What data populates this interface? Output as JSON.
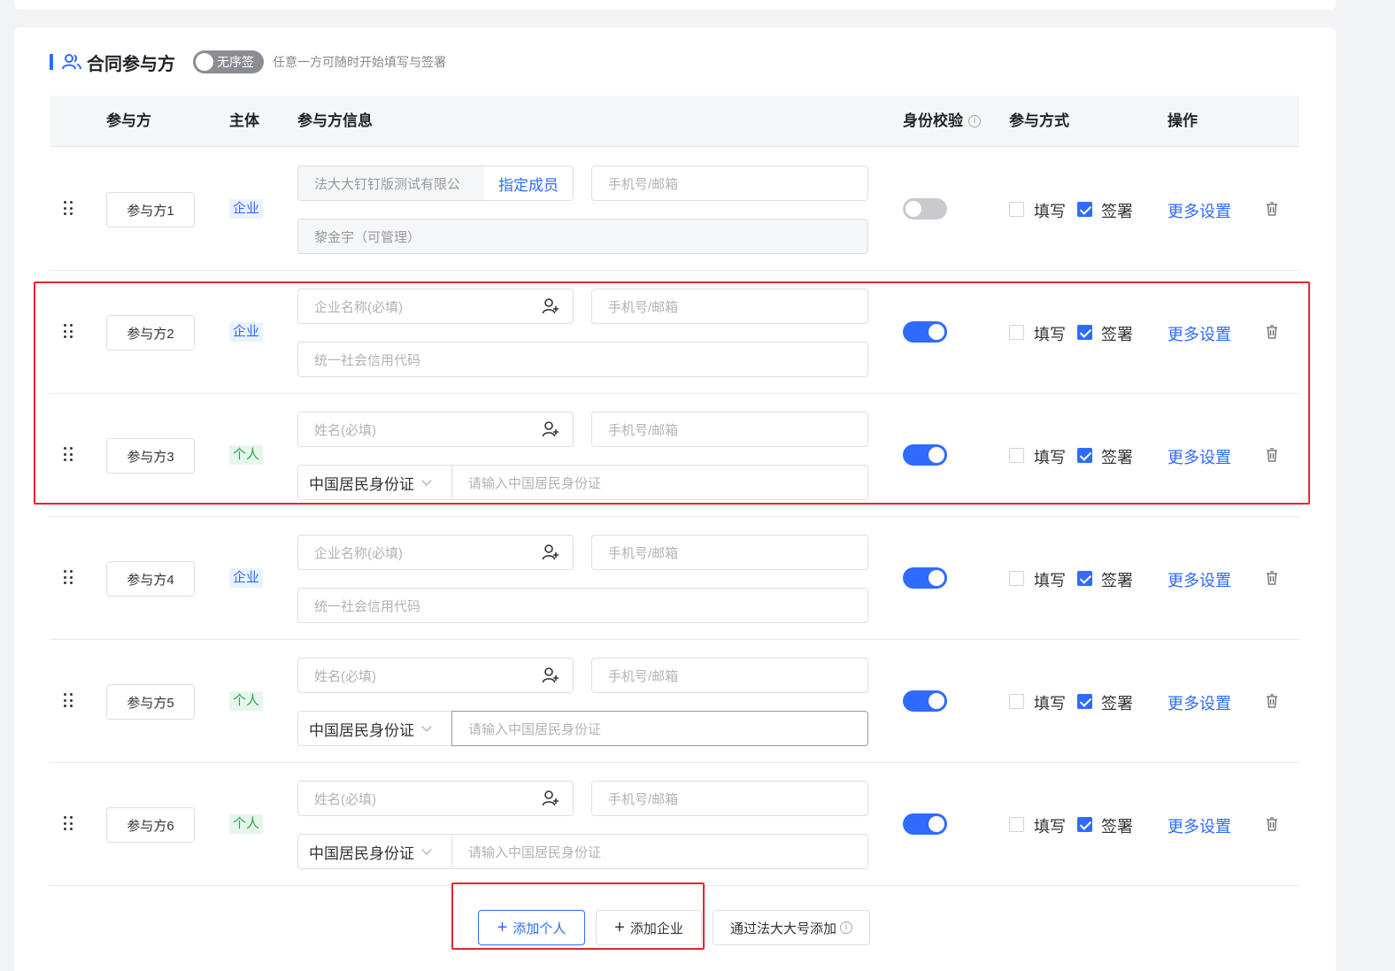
{
  "section": {
    "title": "合同参与方",
    "sequence_toggle_label": "无序签",
    "description": "任意一方可随时开始填写与签署"
  },
  "table_headers": {
    "participant": "参与方",
    "subject": "主体",
    "info": "参与方信息",
    "identity_check": "身份校验",
    "mode": "参与方式",
    "actions": "操作"
  },
  "labels": {
    "fill": "填写",
    "sign": "签署",
    "more_settings": "更多设置",
    "info_glyph": "i"
  },
  "rows": [
    {
      "name": "参与方1",
      "type": "企业",
      "kind": "enterprise-existing",
      "company_value": "法大大钉钉版测试有限公",
      "assign_member": "指定成员",
      "contact_placeholder": "手机号/邮箱",
      "member_value": "黎金宇（可管理）",
      "identity_check": false,
      "fill": false,
      "sign": true
    },
    {
      "name": "参与方2",
      "type": "企业",
      "kind": "enterprise",
      "name_placeholder": "企业名称(必填)",
      "contact_placeholder": "手机号/邮箱",
      "code_placeholder": "统一社会信用代码",
      "identity_check": true,
      "fill": false,
      "sign": true
    },
    {
      "name": "参与方3",
      "type": "个人",
      "kind": "person",
      "name_placeholder": "姓名(必填)",
      "contact_placeholder": "手机号/邮箱",
      "id_type": "中国居民身份证",
      "id_placeholder": "请输入中国居民身份证",
      "identity_check": true,
      "fill": false,
      "sign": true
    },
    {
      "name": "参与方4",
      "type": "企业",
      "kind": "enterprise",
      "name_placeholder": "企业名称(必填)",
      "contact_placeholder": "手机号/邮箱",
      "code_placeholder": "统一社会信用代码",
      "identity_check": true,
      "fill": false,
      "sign": true
    },
    {
      "name": "参与方5",
      "type": "个人",
      "kind": "person",
      "name_placeholder": "姓名(必填)",
      "contact_placeholder": "手机号/邮箱",
      "id_type": "中国居民身份证",
      "id_placeholder": "请输入中国居民身份证",
      "identity_check": true,
      "fill": false,
      "sign": true
    },
    {
      "name": "参与方6",
      "type": "个人",
      "kind": "person",
      "name_placeholder": "姓名(必填)",
      "contact_placeholder": "手机号/邮箱",
      "id_type": "中国居民身份证",
      "id_placeholder": "请输入中国居民身份证",
      "identity_check": true,
      "fill": false,
      "sign": true
    }
  ],
  "buttons": {
    "add_person": "添加个人",
    "add_company": "添加企业",
    "add_via_account": "通过法大大号添加",
    "plus_glyph": "+"
  },
  "colors": {
    "accent": "#2f6bff",
    "highlight": "#e5262b",
    "enterprise_badge": "#2f6bff",
    "person_badge": "#26a84a"
  }
}
